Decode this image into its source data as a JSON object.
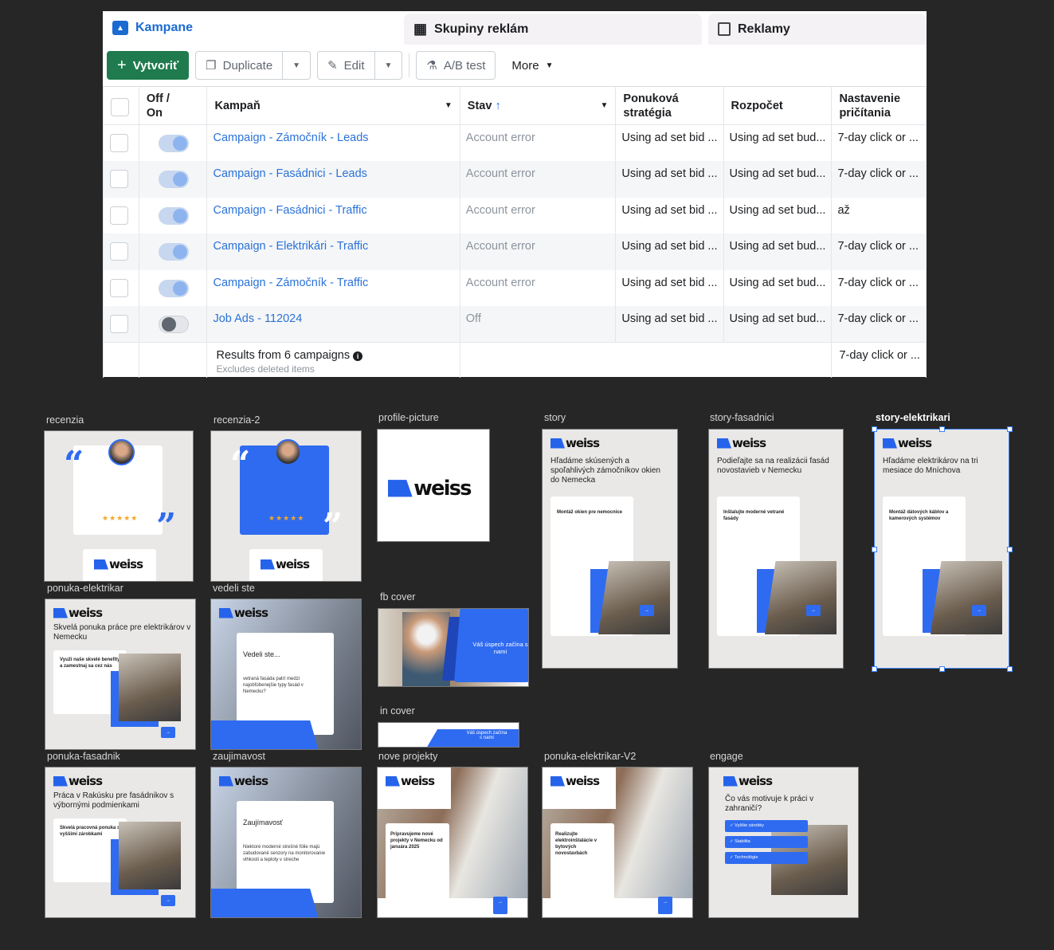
{
  "tabs": [
    {
      "label": "Kampane",
      "icon": "folder-icon",
      "active": true
    },
    {
      "label": "Skupiny reklám",
      "icon": "grid-icon"
    },
    {
      "label": "Reklamy",
      "icon": "ad-icon"
    }
  ],
  "toolbar": {
    "create": "Vytvoriť",
    "duplicate": "Duplicate",
    "edit": "Edit",
    "ab_test": "A/B test",
    "more": "More"
  },
  "columns": {
    "toggle": "Off / On",
    "campaign": "Kampaň",
    "status": "Stav",
    "bid": "Ponuková stratégia",
    "budget": "Rozpočet",
    "attribution": "Nastavenie pričítania"
  },
  "rows": [
    {
      "on": true,
      "name": "Campaign - Zámočník - Leads",
      "status": "Account error",
      "bid": "Using ad set bid ...",
      "budget": "Using ad set bud...",
      "attribution": "7-day click or ..."
    },
    {
      "on": true,
      "name": "Campaign - Fasádnici - Leads",
      "status": "Account error",
      "bid": "Using ad set bid ...",
      "budget": "Using ad set bud...",
      "attribution": "7-day click or ..."
    },
    {
      "on": true,
      "name": "Campaign - Fasádnici - Traffic",
      "status": "Account error",
      "bid": "Using ad set bid ...",
      "budget": "Using ad set bud...",
      "attribution": "až"
    },
    {
      "on": true,
      "name": "Campaign - Elektrikári - Traffic",
      "status": "Account error",
      "bid": "Using ad set bid ...",
      "budget": "Using ad set bud...",
      "attribution": "7-day click or ..."
    },
    {
      "on": true,
      "name": "Campaign - Zámočník - Traffic",
      "status": "Account error",
      "bid": "Using ad set bid ...",
      "budget": "Using ad set bud...",
      "attribution": "7-day click or ..."
    },
    {
      "on": false,
      "name": "Job Ads - 112024",
      "status": "Off",
      "bid": "Using ad set bid ...",
      "budget": "Using ad set bud...",
      "attribution": "7-day click or ..."
    }
  ],
  "footer": {
    "results": "Results from 6 campaigns",
    "excludes": "Excludes deleted items",
    "attribution": "7-day click or ..."
  },
  "colors": {
    "accent": "#1b6ad2",
    "create_button": "#1f7b4d",
    "brand_blue": "#2f6bf0"
  },
  "brand": "weiss",
  "frames": [
    {
      "label": "recenzia",
      "type": "review",
      "stars": "★★★★★"
    },
    {
      "label": "recenzia-2",
      "type": "review-blue",
      "stars": "★★★★★"
    },
    {
      "label": "profile-picture",
      "type": "logo"
    },
    {
      "label": "story",
      "type": "story",
      "headline": "Hľadáme skúsených a spoľahlivých zámočníkov okien do Nemecka",
      "box": "Montáž okien pre nemocnice"
    },
    {
      "label": "story-fasadnici",
      "type": "story",
      "headline": "Podieľajte sa na realizácii fasád novostavieb v Nemecku",
      "box": "Inštalujte moderné vetrané fasády"
    },
    {
      "label": "story-elektrikari",
      "type": "story",
      "selected": true,
      "headline": "Hľadáme elektrikárov na tri mesiace do Mníchova",
      "box": "Montáž dátových káblov a kamerových systémov"
    },
    {
      "label": "ponuka-elektrikar",
      "type": "offer",
      "headline": "Skvelá ponuka práce pre elektrikárov v Nemecku",
      "box": "Využi naše skvelé benefity a zamestnaj sa cez nás"
    },
    {
      "label": "vedeli ste",
      "type": "fact",
      "headline": "Vedeli ste...",
      "box": "vetraná fasáda patrí medzi najobľúbenejšie typy fasád v Nemecku?"
    },
    {
      "label": "fb cover",
      "type": "cover",
      "headline": "Váš úspech začína s nami"
    },
    {
      "label": "in cover",
      "type": "cover-thin",
      "headline": "Váš úspech začína s nami"
    },
    {
      "label": "ponuka-fasadnik",
      "type": "offer",
      "headline": "Práca v Rakúsku pre fasádnikov s výbornými podmienkami",
      "box": "Skvelá pracovná ponuka s vyššími zárobkami"
    },
    {
      "label": "zaujimavost",
      "type": "fact",
      "headline": "Zaujímavosť",
      "box": "Niektoré moderné strešné fólie majú zabudované senzory na monitorovanie vlhkosti a teploty v streche"
    },
    {
      "label": "nove projekty",
      "type": "photo",
      "box": "Pripravujeme nové projekty v Nemecku od januára 2025"
    },
    {
      "label": "ponuka-elektrikar-V2",
      "type": "photo",
      "box": "Realizujte elektroinštalácie v bytových novostavbách"
    },
    {
      "label": "engage",
      "type": "engage",
      "headline": "Čo vás motivuje k práci v zahraničí?",
      "options": [
        "Vyššie zárobky",
        "Stabilita",
        "Technológie"
      ]
    }
  ]
}
